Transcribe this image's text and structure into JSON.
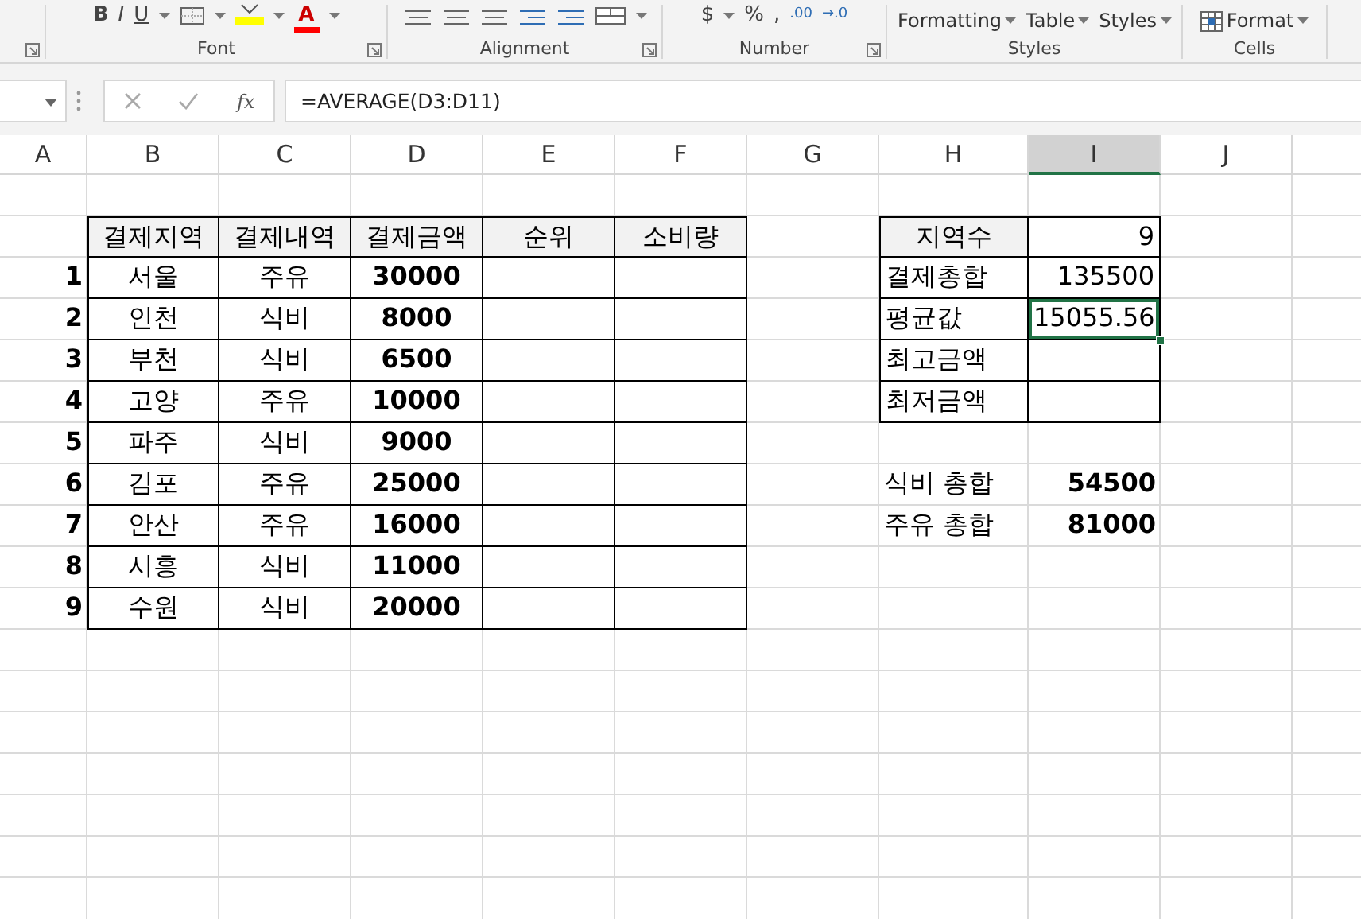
{
  "ribbon": {
    "groups": [
      {
        "dialog_launcher": true
      },
      {
        "label": "Font",
        "dialog_launcher": true,
        "tools": [
          {
            "kind": "bold",
            "text": "B"
          },
          {
            "kind": "italic",
            "text": "I"
          },
          {
            "kind": "underline",
            "text": "U"
          },
          {
            "kind": "caret"
          },
          {
            "kind": "borders"
          },
          {
            "kind": "caret"
          },
          {
            "kind": "fill-color",
            "color": "#ffff00"
          },
          {
            "kind": "caret"
          },
          {
            "kind": "font-color",
            "text": "A",
            "color": "#ff0000"
          },
          {
            "kind": "caret"
          }
        ]
      },
      {
        "label": "Alignment",
        "dialog_launcher": true,
        "tools": [
          {
            "kind": "align"
          },
          {
            "kind": "align"
          },
          {
            "kind": "align"
          },
          {
            "kind": "indent"
          },
          {
            "kind": "indent"
          },
          {
            "kind": "merge"
          },
          {
            "kind": "caret"
          }
        ]
      },
      {
        "label": "Number",
        "dialog_launcher": true,
        "tools": [
          {
            "kind": "text",
            "text": "$"
          },
          {
            "kind": "caret"
          },
          {
            "kind": "text",
            "text": "%"
          },
          {
            "kind": "text",
            "text": ","
          },
          {
            "kind": "small-text",
            "text": ".00"
          },
          {
            "kind": "small-text",
            "text": "→.0"
          }
        ]
      },
      {
        "label": "Styles",
        "dialog_launcher": false,
        "tools": [
          {
            "kind": "menu",
            "text": "Formatting"
          },
          {
            "kind": "menu",
            "text": "Table"
          },
          {
            "kind": "menu",
            "text": "Styles"
          }
        ]
      },
      {
        "label": "Cells",
        "dialog_launcher": false,
        "tools": [
          {
            "kind": "format-menu",
            "text": "Format"
          }
        ]
      }
    ]
  },
  "formula_bar": {
    "function_label": "fx",
    "formula": "=AVERAGE(D3:D11)"
  },
  "columns": [
    {
      "label": "A",
      "selected": false
    },
    {
      "label": "B",
      "selected": false
    },
    {
      "label": "C",
      "selected": false
    },
    {
      "label": "D",
      "selected": false
    },
    {
      "label": "E",
      "selected": false
    },
    {
      "label": "F",
      "selected": false
    },
    {
      "label": "G",
      "selected": false
    },
    {
      "label": "H",
      "selected": false
    },
    {
      "label": "I",
      "selected": true
    },
    {
      "label": "J",
      "selected": false
    },
    {
      "selected": false
    }
  ],
  "rows": [
    {
      "cells": []
    },
    {
      "cells": [
        {},
        {
          "kind": "header",
          "text": "결제지역",
          "selected": false
        },
        {
          "kind": "header",
          "text": "결제내역",
          "selected": false
        },
        {
          "kind": "header",
          "text": "결제금액",
          "selected": false
        },
        {
          "kind": "header",
          "text": "순위",
          "selected": false
        },
        {
          "kind": "header",
          "text": "소비량",
          "selected": false
        },
        {},
        {
          "kind": "header",
          "text": "지역수",
          "selected": false
        },
        {
          "kind": "value",
          "text": "9",
          "selected": false
        }
      ]
    },
    {
      "cells": [
        {
          "kind": "index",
          "text": "1",
          "selected": false
        },
        {
          "kind": "item",
          "text": "서울",
          "selected": false
        },
        {
          "kind": "item",
          "text": "주유",
          "selected": false
        },
        {
          "kind": "amount",
          "text": "30000",
          "selected": false
        },
        {
          "kind": "blank",
          "selected": false
        },
        {
          "kind": "blank",
          "selected": false
        },
        {},
        {
          "kind": "label",
          "text": "결제총합",
          "selected": false
        },
        {
          "kind": "value",
          "text": "135500",
          "selected": false
        }
      ]
    },
    {
      "cells": [
        {
          "kind": "index",
          "text": "2",
          "selected": false
        },
        {
          "kind": "item",
          "text": "인천",
          "selected": false
        },
        {
          "kind": "item",
          "text": "식비",
          "selected": false
        },
        {
          "kind": "amount",
          "text": "8000",
          "selected": false
        },
        {
          "kind": "blank",
          "selected": false
        },
        {
          "kind": "blank",
          "selected": false
        },
        {},
        {
          "kind": "label",
          "text": "평균값",
          "selected": false
        },
        {
          "kind": "value",
          "text": "15055.56",
          "selected": true
        }
      ]
    },
    {
      "cells": [
        {
          "kind": "index",
          "text": "3",
          "selected": false
        },
        {
          "kind": "item",
          "text": "부천",
          "selected": false
        },
        {
          "kind": "item",
          "text": "식비",
          "selected": false
        },
        {
          "kind": "amount",
          "text": "6500",
          "selected": false
        },
        {
          "kind": "blank",
          "selected": false
        },
        {
          "kind": "blank",
          "selected": false
        },
        {},
        {
          "kind": "label",
          "text": "최고금액",
          "selected": false
        },
        {
          "kind": "blank",
          "selected": false
        }
      ]
    },
    {
      "cells": [
        {
          "kind": "index",
          "text": "4",
          "selected": false
        },
        {
          "kind": "item",
          "text": "고양",
          "selected": false
        },
        {
          "kind": "item",
          "text": "주유",
          "selected": false
        },
        {
          "kind": "amount",
          "text": "10000",
          "selected": false
        },
        {
          "kind": "blank",
          "selected": false
        },
        {
          "kind": "blank",
          "selected": false
        },
        {},
        {
          "kind": "label",
          "text": "최저금액",
          "selected": false
        },
        {
          "kind": "blank",
          "selected": false
        }
      ]
    },
    {
      "cells": [
        {
          "kind": "index",
          "text": "5",
          "selected": false
        },
        {
          "kind": "item",
          "text": "파주",
          "selected": false
        },
        {
          "kind": "item",
          "text": "식비",
          "selected": false
        },
        {
          "kind": "amount",
          "text": "9000",
          "selected": false
        },
        {
          "kind": "blank",
          "selected": false
        },
        {
          "kind": "blank",
          "selected": false
        }
      ]
    },
    {
      "cells": [
        {
          "kind": "index",
          "text": "6",
          "selected": false
        },
        {
          "kind": "item",
          "text": "김포",
          "selected": false
        },
        {
          "kind": "item",
          "text": "주유",
          "selected": false
        },
        {
          "kind": "amount",
          "text": "25000",
          "selected": false
        },
        {
          "kind": "blank",
          "selected": false
        },
        {
          "kind": "blank",
          "selected": false
        },
        {},
        {
          "kind": "summary-label",
          "text": "식비 총합",
          "selected": false
        },
        {
          "kind": "summary-value",
          "text": "54500",
          "selected": false
        }
      ]
    },
    {
      "cells": [
        {
          "kind": "index",
          "text": "7",
          "selected": false
        },
        {
          "kind": "item",
          "text": "안산",
          "selected": false
        },
        {
          "kind": "item",
          "text": "주유",
          "selected": false
        },
        {
          "kind": "amount",
          "text": "16000",
          "selected": false
        },
        {
          "kind": "blank",
          "selected": false
        },
        {
          "kind": "blank",
          "selected": false
        },
        {},
        {
          "kind": "summary-label",
          "text": "주유 총합",
          "selected": false
        },
        {
          "kind": "summary-value",
          "text": "81000",
          "selected": false
        }
      ]
    },
    {
      "cells": [
        {
          "kind": "index",
          "text": "8",
          "selected": false
        },
        {
          "kind": "item",
          "text": "시흥",
          "selected": false
        },
        {
          "kind": "item",
          "text": "식비",
          "selected": false
        },
        {
          "kind": "amount",
          "text": "11000",
          "selected": false
        },
        {
          "kind": "blank",
          "selected": false
        },
        {
          "kind": "blank",
          "selected": false
        }
      ]
    },
    {
      "cells": [
        {
          "kind": "index",
          "text": "9",
          "selected": false
        },
        {
          "kind": "item",
          "text": "수원",
          "selected": false
        },
        {
          "kind": "item",
          "text": "식비",
          "selected": false
        },
        {
          "kind": "amount",
          "text": "20000",
          "selected": false
        },
        {
          "kind": "blank",
          "selected": false
        },
        {
          "kind": "blank",
          "selected": false
        }
      ]
    }
  ]
}
